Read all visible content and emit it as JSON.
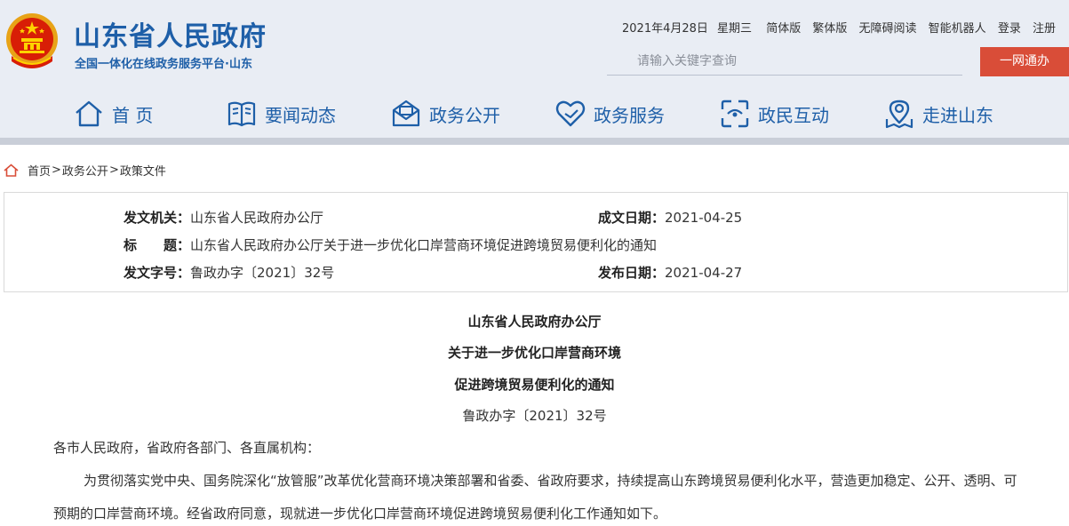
{
  "header": {
    "title": "山东省人民政府",
    "subtitle": "全国一体化在线政务服务平台·山东",
    "emblem": "national-emblem"
  },
  "toplinks": {
    "date": "2021年4月28日",
    "weekday": "星期三",
    "items": [
      "简体版",
      "繁体版",
      "无障碍阅读",
      "智能机器人",
      "登录",
      "注册"
    ]
  },
  "search": {
    "placeholder": "请输入关键字查询",
    "button": "一网通办"
  },
  "nav": [
    {
      "label": "首 页",
      "icon": "home-icon"
    },
    {
      "label": "要闻动态",
      "icon": "book-icon"
    },
    {
      "label": "政务公开",
      "icon": "inbox-icon"
    },
    {
      "label": "政务服务",
      "icon": "heart-icon"
    },
    {
      "label": "政民互动",
      "icon": "interaction-icon"
    },
    {
      "label": "走进山东",
      "icon": "location-icon"
    }
  ],
  "breadcrumb": {
    "items": [
      "首页",
      "政务公开",
      "政策文件"
    ],
    "separator": ">"
  },
  "meta": {
    "issuer_key": "发文机关：",
    "issuer": "山东省人民政府办公厅",
    "date_key": "成文日期：",
    "date": "2021-04-25",
    "title_key": "标　　题：",
    "title": "山东省人民政府办公厅关于进一步优化口岸营商环境促进跨境贸易便利化的通知",
    "number_key": "发文字号：",
    "number": "鲁政办字〔2021〕32号",
    "publish_key": "发布日期：",
    "publish": "2021-04-27"
  },
  "document": {
    "title_lines": [
      "山东省人民政府办公厅",
      "关于进一步优化口岸营商环境",
      "促进跨境贸易便利化的通知"
    ],
    "number": "鲁政办字〔2021〕32号",
    "addressee": "各市人民政府，省政府各部门、各直属机构：",
    "paragraph": "为贯彻落实党中央、国务院深化“放管服”改革优化营商环境决策部署和省委、省政府要求，持续提高山东跨境贸易便利化水平，营造更加稳定、公开、透明、可预期的口岸营商环境。经省政府同意，现就进一步优化口岸营商环境促进跨境贸易便利化工作通知如下。"
  },
  "colors": {
    "brand_blue": "#1e5fa8",
    "header_bg": "#e9edf4",
    "search_button": "#d94d38"
  }
}
